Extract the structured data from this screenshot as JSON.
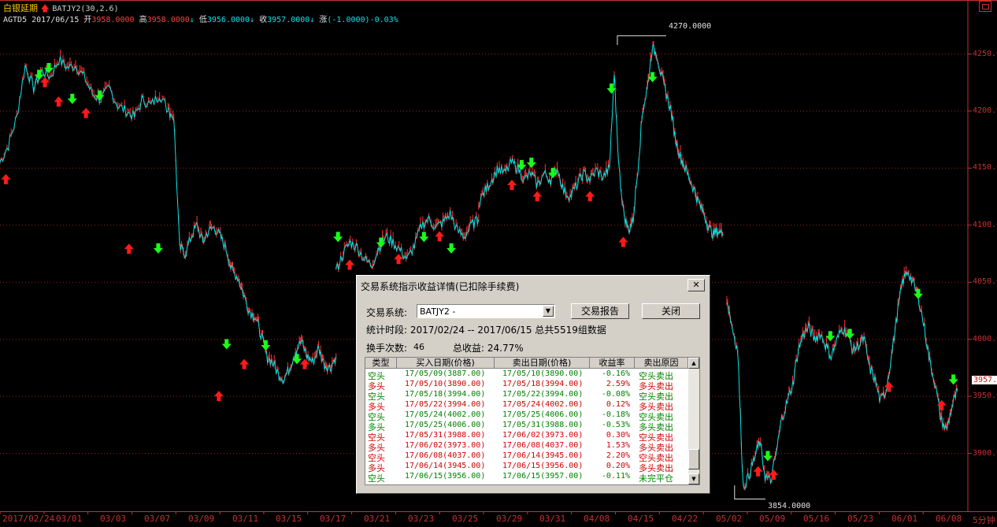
{
  "header": {
    "symbol_name": "白银延期",
    "indicator": "BATJY2(30,2.6)",
    "code": "AGTD5",
    "date": "2017/06/15",
    "open_label": "开",
    "open": "3958.0000",
    "high_label": "高",
    "high": "3958.0000",
    "low_label": "低",
    "low": "3956.0000",
    "close_label": "收",
    "close": "3957.0000",
    "change_label": "涨",
    "change": "(-1.0000)",
    "change_pct": "-0.03%",
    "arrow": "↓"
  },
  "chart_data": {
    "type": "line",
    "y_ticks": [
      "4250.0",
      "4200.0",
      "4150.0",
      "4100.0",
      "4050.0",
      "4000.0",
      "3950.0",
      "3900.0"
    ],
    "ylim": [
      3850,
      4278
    ],
    "x_ticks": [
      "2017/02/24",
      "03/01",
      "03/03",
      "03/07",
      "03/09",
      "03/11",
      "03/15",
      "03/17",
      "03/21",
      "03/23",
      "03/25",
      "03/29",
      "03/31",
      "04/08",
      "04/15",
      "04/22",
      "05/02",
      "05/09",
      "05/16",
      "05/23",
      "06/01",
      "06/08"
    ],
    "x_unit": "5分钟",
    "annotations": {
      "max": "4270.0000",
      "min": "3854.0000",
      "last": "3957.0"
    },
    "segments": [
      {
        "from": 0,
        "to": 8.6,
        "values": [
          4155,
          4170,
          4195,
          4240,
          4220,
          4235,
          4230,
          4245,
          4238,
          4240,
          4230,
          4215,
          4210,
          4220,
          4205,
          4200,
          4195,
          4210,
          4205,
          4215,
          4200
        ]
      },
      {
        "from": 8.6,
        "to": 17.2,
        "values": [
          4200,
          4195,
          4080,
          4075,
          4090,
          4100,
          4085,
          4095,
          4098,
          4090,
          4080,
          4060,
          4055,
          4040,
          4025,
          4020,
          4005,
          3985,
          3980,
          3970,
          3965,
          3975,
          3990,
          3998,
          3985,
          3980,
          3992,
          3978,
          3975,
          3985
        ]
      },
      {
        "from": 17.2,
        "to": 24.5,
        "values": [
          4060,
          4075,
          4085,
          4080,
          4070,
          4065,
          4080,
          4090,
          4085,
          4078,
          4070,
          4082,
          4100,
          4105,
          4098,
          4102,
          4110,
          4095,
          4090,
          4100,
          4105
        ]
      },
      {
        "from": 24.5,
        "to": 31.2,
        "values": [
          4120,
          4130,
          4140,
          4150,
          4145,
          4155,
          4150,
          4140,
          4145,
          4135,
          4145,
          4140,
          4150,
          4130,
          4125,
          4135,
          4145,
          4140,
          4148,
          4142,
          4150
        ]
      },
      {
        "from": 31.2,
        "to": 37,
        "values": [
          4150,
          4230,
          4150,
          4110,
          4095,
          4105,
          4150,
          4200,
          4220,
          4255,
          4250,
          4230,
          4215,
          4200,
          4175,
          4160,
          4150,
          4140,
          4130,
          4118,
          4110,
          4098,
          4092,
          4095,
          4092
        ]
      },
      {
        "from": 37.2,
        "to": 49,
        "values": [
          4035,
          4010,
          3990,
          3870,
          3880,
          3895,
          3910,
          3880,
          3875,
          3900,
          3930,
          3945,
          3960,
          3990,
          4005,
          4010,
          4000,
          4005,
          3995,
          3985,
          3998,
          4010,
          4005,
          3990,
          3995,
          4000,
          3975,
          3965,
          3945,
          3955,
          3985,
          4020,
          4050,
          4060,
          4048,
          4035,
          4010,
          3980,
          3960,
          3930,
          3920,
          3940,
          3955
        ]
      }
    ],
    "buy_markers": [
      [
        0.3,
        4140
      ],
      [
        2.3,
        4225
      ],
      [
        3,
        4208
      ],
      [
        4.4,
        4198
      ],
      [
        6.6,
        4079
      ],
      [
        11.2,
        3950
      ],
      [
        12.5,
        3978
      ],
      [
        15.6,
        3978
      ],
      [
        17.9,
        4065
      ],
      [
        20.4,
        4070
      ],
      [
        22.5,
        4090
      ],
      [
        26.2,
        4135
      ],
      [
        27.5,
        4125
      ],
      [
        30.2,
        4125
      ],
      [
        31.9,
        4085
      ],
      [
        38.8,
        3884
      ],
      [
        39.6,
        3881
      ],
      [
        45.5,
        3958
      ],
      [
        48.2,
        3942
      ]
    ],
    "sell_markers": [
      [
        2,
        4232
      ],
      [
        2.5,
        4238
      ],
      [
        3.7,
        4211
      ],
      [
        5.1,
        4214
      ],
      [
        8.1,
        4080
      ],
      [
        11.6,
        3996
      ],
      [
        13.6,
        3995
      ],
      [
        15.2,
        3983
      ],
      [
        17.3,
        4090
      ],
      [
        19.5,
        4085
      ],
      [
        21.7,
        4090
      ],
      [
        23.1,
        4080
      ],
      [
        26.7,
        4153
      ],
      [
        27.2,
        4155
      ],
      [
        28.3,
        4146
      ],
      [
        31.3,
        4220
      ],
      [
        33.4,
        4230
      ],
      [
        39.3,
        3898
      ],
      [
        42.5,
        4003
      ],
      [
        43.5,
        4005
      ],
      [
        47,
        4040
      ],
      [
        48.8,
        3965
      ]
    ]
  },
  "dialog": {
    "title": "交易系统指示收益详情(已扣除手续费)",
    "close_x": "✕",
    "system_label": "交易系统:",
    "system_value": "BATJY2 -",
    "report_button": "交易报告",
    "close_button": "关闭",
    "period_label": "统计时段:",
    "period_value": "2017/02/24 -- 2017/06/15 总共5519组数据",
    "trades_label": "换手次数:",
    "trades_value": "46",
    "profit_label": "总收益:",
    "profit_value": "24.77%",
    "columns": [
      "类型",
      "买入日期(价格)",
      "卖出日期(价格)",
      "收益率",
      "卖出原因"
    ],
    "rows": [
      {
        "kind": "short",
        "type": "空头",
        "buy": "17/05/09(3887.00)",
        "sell": "17/05/10(3890.00)",
        "ret": "-0.16%",
        "reason": "空头卖出"
      },
      {
        "kind": "long",
        "type": "多头",
        "buy": "17/05/10(3890.00)",
        "sell": "17/05/18(3994.00)",
        "ret": "2.59%",
        "reason": "多头卖出"
      },
      {
        "kind": "short",
        "type": "空头",
        "buy": "17/05/18(3994.00)",
        "sell": "17/05/22(3994.00)",
        "ret": "-0.08%",
        "reason": "空头卖出"
      },
      {
        "kind": "long",
        "type": "多头",
        "buy": "17/05/22(3994.00)",
        "sell": "17/05/24(4002.00)",
        "ret": "0.12%",
        "reason": "多头卖出"
      },
      {
        "kind": "short",
        "type": "空头",
        "buy": "17/05/24(4002.00)",
        "sell": "17/05/25(4006.00)",
        "ret": "-0.18%",
        "reason": "空头卖出"
      },
      {
        "kind": "short",
        "type": "多头",
        "buy": "17/05/25(4006.00)",
        "sell": "17/05/31(3988.00)",
        "ret": "-0.53%",
        "reason": "多头卖出"
      },
      {
        "kind": "long",
        "type": "空头",
        "buy": "17/05/31(3988.00)",
        "sell": "17/06/02(3973.00)",
        "ret": "0.30%",
        "reason": "空头卖出"
      },
      {
        "kind": "long",
        "type": "多头",
        "buy": "17/06/02(3973.00)",
        "sell": "17/06/08(4037.00)",
        "ret": "1.53%",
        "reason": "多头卖出"
      },
      {
        "kind": "long",
        "type": "空头",
        "buy": "17/06/08(4037.00)",
        "sell": "17/06/14(3945.00)",
        "ret": "2.20%",
        "reason": "空头卖出"
      },
      {
        "kind": "long",
        "type": "多头",
        "buy": "17/06/14(3945.00)",
        "sell": "17/06/15(3956.00)",
        "ret": "0.20%",
        "reason": "多头卖出"
      },
      {
        "kind": "short",
        "type": "空头",
        "buy": "17/06/15(3956.00)",
        "sell": "17/06/15(3957.00)",
        "ret": "-0.11%",
        "reason": "未完平仓"
      }
    ]
  }
}
